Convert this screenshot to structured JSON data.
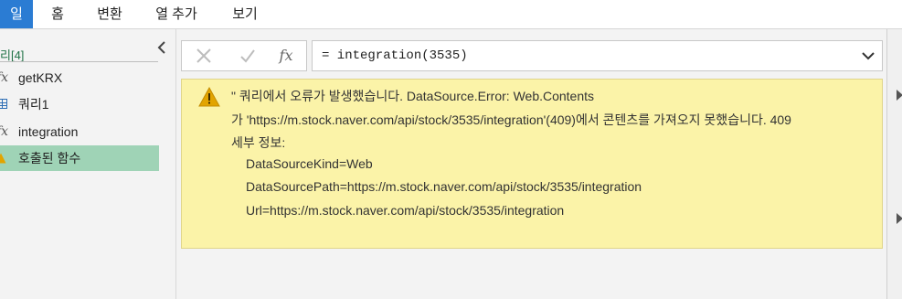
{
  "ribbon": {
    "tabs": [
      {
        "label": "일",
        "active": true
      },
      {
        "label": "홈",
        "active": false
      },
      {
        "label": "변환",
        "active": false
      },
      {
        "label": "열 추가",
        "active": false
      },
      {
        "label": "보기",
        "active": false
      }
    ]
  },
  "queries": {
    "header": "리[4]",
    "items": [
      {
        "label": "getKRX",
        "icon": "function-icon"
      },
      {
        "label": "쿼리1",
        "icon": "table-icon"
      },
      {
        "label": "integration",
        "icon": "function-icon"
      },
      {
        "label": "호출된 함수",
        "icon": "warning-icon",
        "selected": true
      }
    ]
  },
  "formula_bar": {
    "cancel_glyph": "✕",
    "commit_glyph": "✓",
    "fx_glyph": "fx",
    "text": "= integration(3535)"
  },
  "error": {
    "lines": [
      "\" 쿼리에서 오류가 발생했습니다. DataSource.Error: Web.Contents",
      "가 'https://m.stock.naver.com/api/stock/3535/integration'(409)에서 콘텐츠를 가져오지 못했습니다. 409",
      "세부 정보:",
      "DataSourceKind=Web",
      "DataSourcePath=https://m.stock.naver.com/api/stock/3535/integration",
      "Url=https://m.stock.naver.com/api/stock/3535/integration"
    ]
  },
  "colors": {
    "accent": "#2b7cd3",
    "selected_row": "#9fd3b6",
    "error_bg": "#fbf3a8",
    "warning": "#e2a400"
  }
}
